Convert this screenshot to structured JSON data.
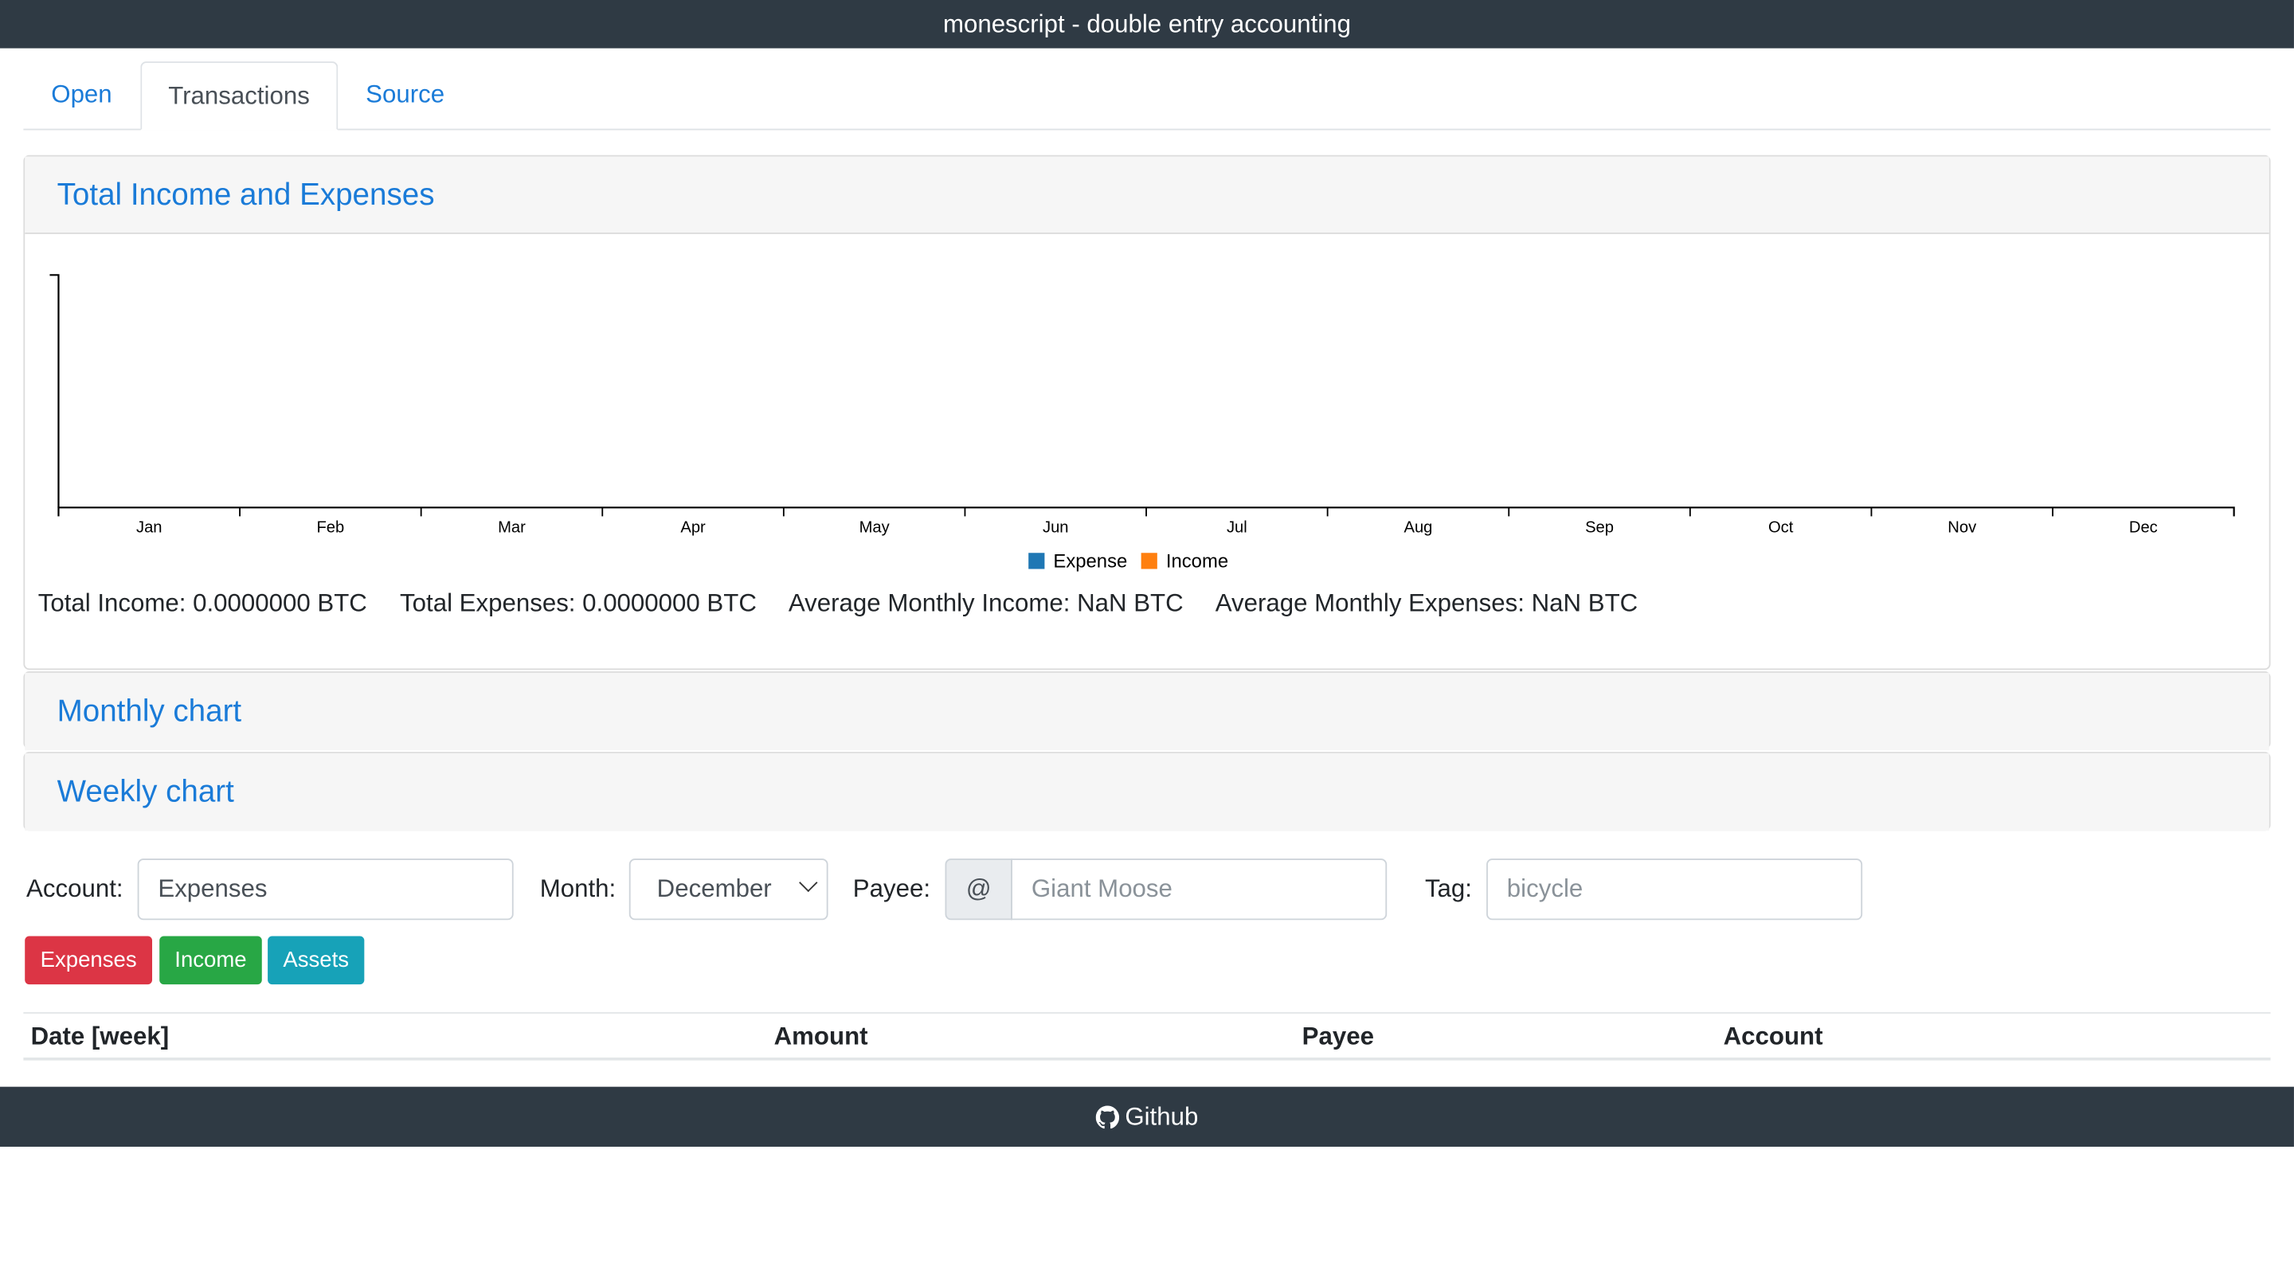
{
  "window": {
    "title": "monescript - double entry accounting"
  },
  "tabs": [
    {
      "label": "Open"
    },
    {
      "label": "Transactions"
    },
    {
      "label": "Source"
    }
  ],
  "panels": {
    "total": {
      "title": "Total Income and Expenses"
    },
    "monthly": {
      "title": "Monthly chart"
    },
    "weekly": {
      "title": "Weekly chart"
    }
  },
  "chart_data": {
    "type": "bar",
    "categories": [
      "Jan",
      "Feb",
      "Mar",
      "Apr",
      "May",
      "Jun",
      "Jul",
      "Aug",
      "Sep",
      "Oct",
      "Nov",
      "Dec"
    ],
    "series": [
      {
        "name": "Expense",
        "color": "#1f77b4",
        "values": [
          0,
          0,
          0,
          0,
          0,
          0,
          0,
          0,
          0,
          0,
          0,
          0
        ]
      },
      {
        "name": "Income",
        "color": "#ff7f0e",
        "values": [
          0,
          0,
          0,
          0,
          0,
          0,
          0,
          0,
          0,
          0,
          0,
          0
        ]
      }
    ],
    "legend": "bottom-center"
  },
  "summary": {
    "total_income": "Total Income: 0.0000000 BTC",
    "total_expenses": "Total Expenses: 0.0000000 BTC",
    "avg_income": "Average Monthly Income: NaN BTC",
    "avg_expenses": "Average Monthly Expenses: NaN BTC"
  },
  "filters": {
    "account_label": "Account:",
    "account_value": "Expenses",
    "month_label": "Month:",
    "month_value": "December",
    "payee_label": "Payee:",
    "payee_addon": "@",
    "payee_placeholder": "Giant Moose",
    "tag_label": "Tag:",
    "tag_placeholder": "bicycle"
  },
  "buttons": {
    "expenses": "Expenses",
    "income": "Income",
    "assets": "Assets"
  },
  "table": {
    "columns": [
      "Date [week]",
      "Amount",
      "Payee",
      "Account"
    ]
  },
  "footer": {
    "link": "Github"
  }
}
